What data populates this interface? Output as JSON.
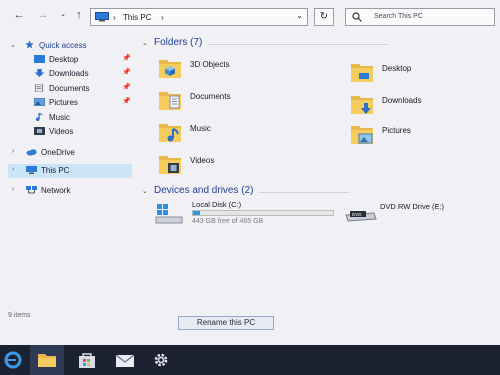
{
  "address": {
    "location_label": "This PC",
    "refresh_symbol": "↻",
    "search_placeholder": "Search This PC"
  },
  "nav": {
    "quick_access": "Quick access",
    "items": [
      {
        "label": "Desktop",
        "icon": "desktop-icon",
        "pinned": true
      },
      {
        "label": "Downloads",
        "icon": "downloads-icon",
        "pinned": true
      },
      {
        "label": "Documents",
        "icon": "documents-icon",
        "pinned": true
      },
      {
        "label": "Pictures",
        "icon": "pictures-icon",
        "pinned": true
      },
      {
        "label": "Music",
        "icon": "music-icon",
        "pinned": false
      },
      {
        "label": "Videos",
        "icon": "videos-icon",
        "pinned": false
      }
    ],
    "onedrive": "OneDrive",
    "this_pc": "This PC",
    "network": "Network"
  },
  "content": {
    "folders_header": "Folders (7)",
    "folders": [
      {
        "name": "3D Objects",
        "icon": "3d-objects-folder-icon"
      },
      {
        "name": "Desktop",
        "icon": "desktop-folder-icon"
      },
      {
        "name": "Documents",
        "icon": "documents-folder-icon"
      },
      {
        "name": "Downloads",
        "icon": "downloads-folder-icon"
      },
      {
        "name": "Music",
        "icon": "music-folder-icon"
      },
      {
        "name": "Pictures",
        "icon": "pictures-folder-icon"
      },
      {
        "name": "Videos",
        "icon": "videos-folder-icon"
      }
    ],
    "drives_header": "Devices and drives (2)",
    "drives": [
      {
        "name": "Local Disk (C:)",
        "free_text": "443 GB free of 465 GB",
        "used_fraction": 0.047
      },
      {
        "name": "DVD RW Drive (E:)"
      }
    ]
  },
  "status": {
    "item_count": "9 items",
    "rename_button": "Rename this PC"
  },
  "colors": {
    "accent": "#26a0da",
    "selection": "#cce4f7",
    "header_text": "#1f3f8f",
    "taskbar": "#1c2232"
  }
}
